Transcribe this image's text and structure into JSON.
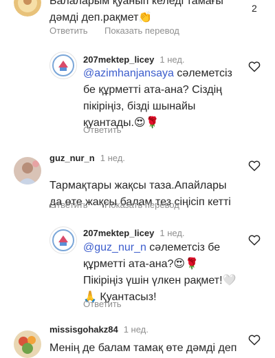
{
  "comments": [
    {
      "text_top": "Балаларым қуанып келеді тамағы",
      "text_bottom": "дәмді деп.рақмет👏",
      "reply": "Ответить",
      "translate": "Показать перевод",
      "likes": "2"
    },
    {
      "username": "207mektep_licey",
      "time": "1 нед.",
      "mention": "@azimhanjansaya",
      "line1": " сәлеметсіз",
      "line2": "бе құрметті ата-ана? Сіздің",
      "line3": "пікіріңіз, бізді шынайы",
      "line4": "қуантады.😍🌹",
      "reply": "Ответить"
    },
    {
      "username": "guz_nur_n",
      "time": "1 нед.",
      "line1": "Тармақтары жақсы таза.Апайлары",
      "line2": "да өте жақсы балам тез сіңісіп кетті",
      "reply": "Ответить",
      "translate": "Показать перевод"
    },
    {
      "username": "207mektep_licey",
      "time": "1 нед.",
      "mention": "@guz_nur_n",
      "line1": " сәлеметсіз бе",
      "line2": "құрметті ата-ана?😍🌹",
      "line3": "Пікіріңіз үшін үлкен рақмет!🤍",
      "line4": "🙏 Қуантасыз!",
      "reply": "Ответить"
    },
    {
      "username": "missisgohakz84",
      "time": "1 нед.",
      "line1": "Менің де балам тамақ өте дәмді деп"
    }
  ],
  "colors": {
    "mention": "#3b5ccc",
    "secondary": "#8e8e8e",
    "text": "#262626"
  },
  "icons": [
    "heart-outline-icon",
    "school-logo-icon",
    "user-photo-avatar"
  ]
}
